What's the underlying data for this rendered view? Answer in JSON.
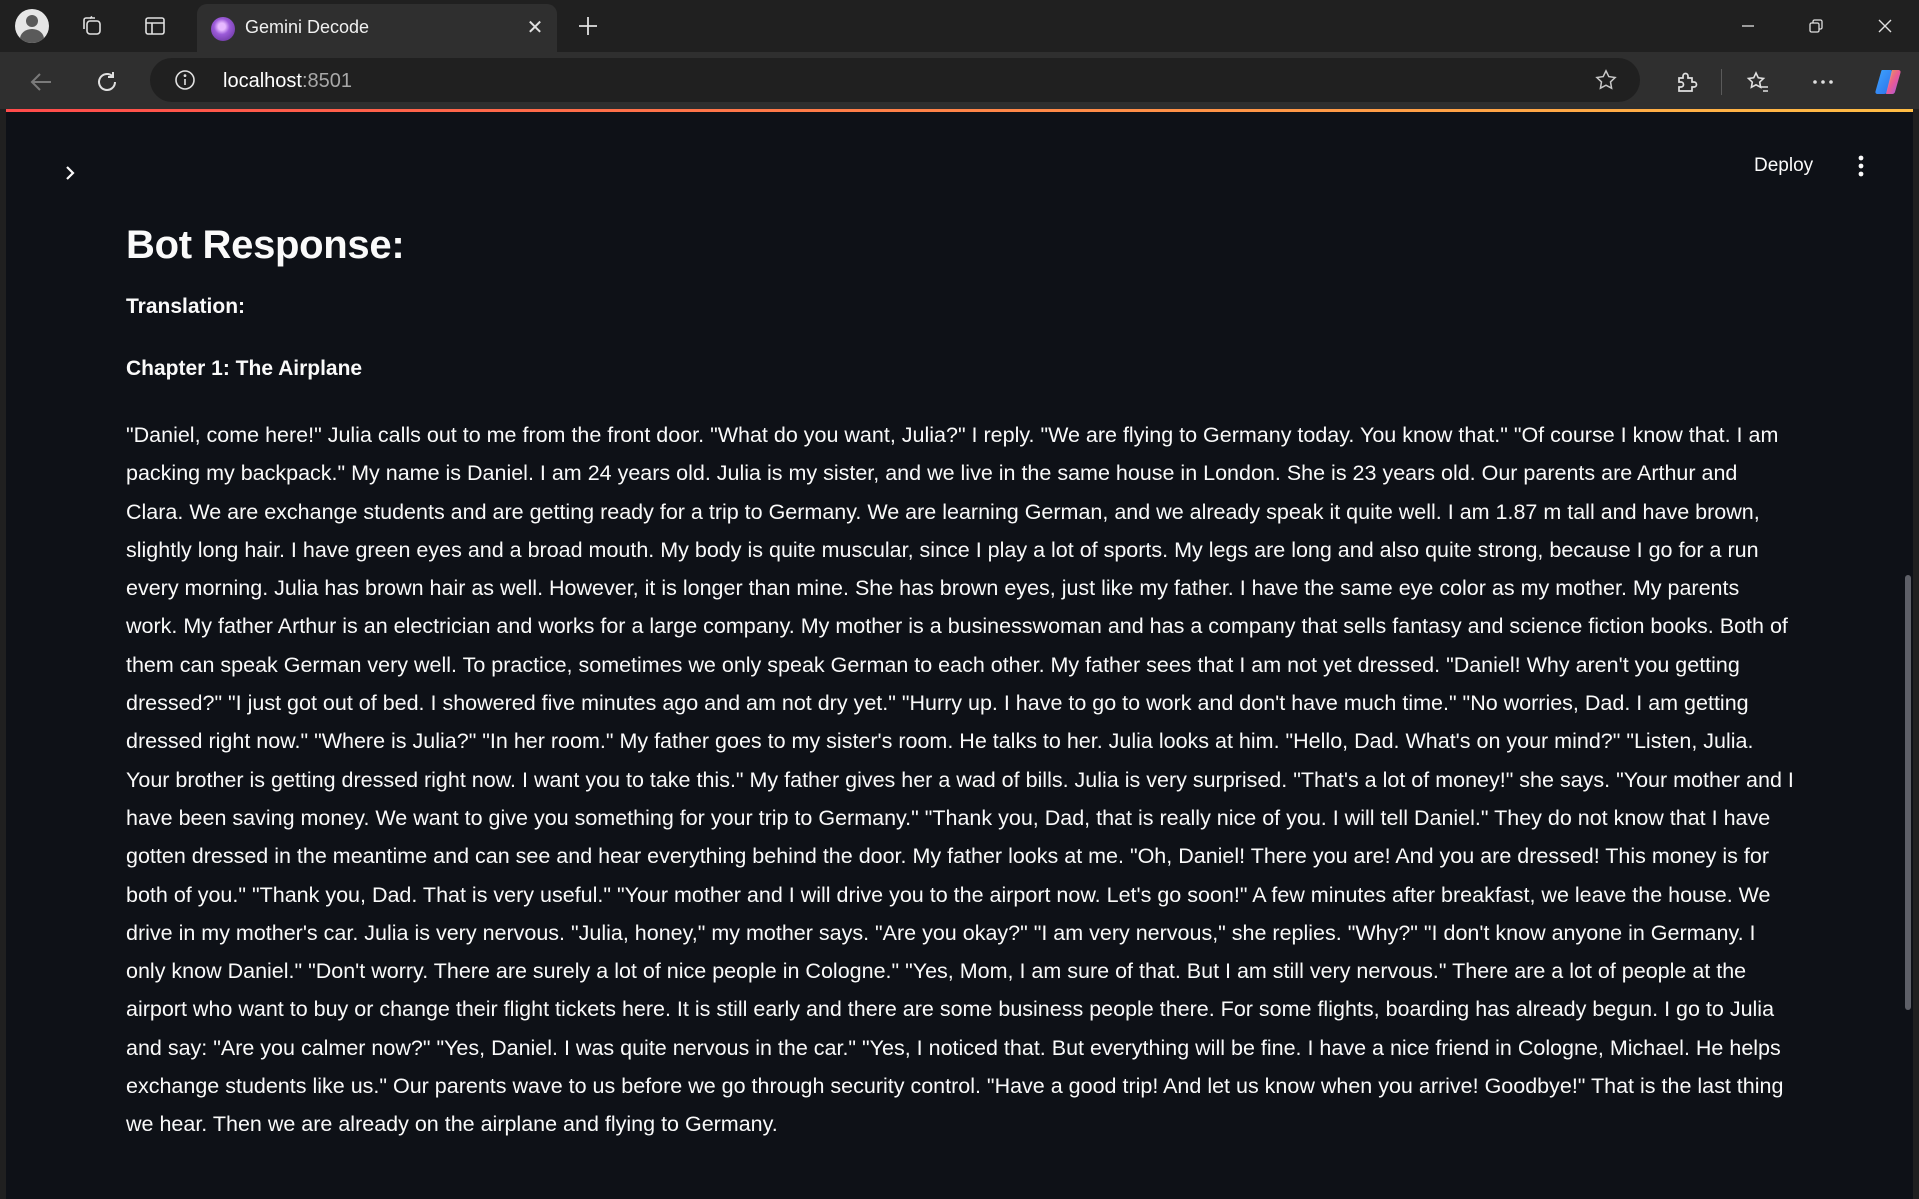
{
  "browser": {
    "tab": {
      "title": "Gemini Decode"
    },
    "url": {
      "host": "localhost",
      "port": ":8501"
    }
  },
  "icons": {
    "profile": "profile-icon",
    "workspaces": "workspaces-icon",
    "tab_actions": "tab-actions-icon",
    "new_tab": "plus-icon",
    "back": "arrow-left-icon",
    "reload": "reload-icon",
    "site_info": "info-icon",
    "favorite": "star-icon",
    "extensions": "puzzle-icon",
    "favorites": "favorites-icon",
    "more": "ellipsis-icon",
    "copilot": "copilot-icon",
    "sidebar_toggle": "chevron-right-icon",
    "app_menu": "vertical-ellipsis-icon"
  },
  "colors": {
    "app_background": "#0e1117",
    "browser_chrome": "#202020",
    "toolbar": "#2f2f2f",
    "text": "#fafafa",
    "accent_gradient_start": "#ff4b4b",
    "accent_gradient_end": "#ffbd45"
  },
  "app": {
    "header": {
      "deploy_label": "Deploy"
    },
    "main": {
      "title": "Bot Response:",
      "translation_label": "Translation:",
      "chapter_title": "Chapter 1: The Airplane",
      "story": "\"Daniel, come here!\" Julia calls out to me from the front door. \"What do you want, Julia?\" I reply. \"We are flying to Germany today. You know that.\" \"Of course I know that. I am packing my backpack.\" My name is Daniel. I am 24 years old. Julia is my sister, and we live in the same house in London. She is 23 years old. Our parents are Arthur and Clara. We are exchange students and are getting ready for a trip to Germany. We are learning German, and we already speak it quite well. I am 1.87 m tall and have brown, slightly long hair. I have green eyes and a broad mouth. My body is quite muscular, since I play a lot of sports. My legs are long and also quite strong, because I go for a run every morning. Julia has brown hair as well. However, it is longer than mine. She has brown eyes, just like my father. I have the same eye color as my mother. My parents work. My father Arthur is an electrician and works for a large company. My mother is a businesswoman and has a company that sells fantasy and science fiction books. Both of them can speak German very well. To practice, sometimes we only speak German to each other. My father sees that I am not yet dressed. \"Daniel! Why aren't you getting dressed?\" \"I just got out of bed. I showered five minutes ago and am not dry yet.\" \"Hurry up. I have to go to work and don't have much time.\" \"No worries, Dad. I am getting dressed right now.\" \"Where is Julia?\" \"In her room.\" My father goes to my sister's room. He talks to her. Julia looks at him. \"Hello, Dad. What's on your mind?\" \"Listen, Julia. Your brother is getting dressed right now. I want you to take this.\" My father gives her a wad of bills. Julia is very surprised. \"That's a lot of money!\" she says. \"Your mother and I have been saving money. We want to give you something for your trip to Germany.\" \"Thank you, Dad, that is really nice of you. I will tell Daniel.\" They do not know that I have gotten dressed in the meantime and can see and hear everything behind the door. My father looks at me. \"Oh, Daniel! There you are! And you are dressed! This money is for both of you.\" \"Thank you, Dad. That is very useful.\" \"Your mother and I will drive you to the airport now. Let's go soon!\" A few minutes after breakfast, we leave the house. We drive in my mother's car. Julia is very nervous. \"Julia, honey,\" my mother says. \"Are you okay?\" \"I am very nervous,\" she replies. \"Why?\" \"I don't know anyone in Germany. I only know Daniel.\" \"Don't worry. There are surely a lot of nice people in Cologne.\" \"Yes, Mom, I am sure of that. But I am still very nervous.\" There are a lot of people at the airport who want to buy or change their flight tickets here. It is still early and there are some business people there. For some flights, boarding has already begun. I go to Julia and say: \"Are you calmer now?\" \"Yes, Daniel. I was quite nervous in the car.\" \"Yes, I noticed that. But everything will be fine. I have a nice friend in Cologne, Michael. He helps exchange students like us.\" Our parents wave to us before we go through security control. \"Have a good trip! And let us know when you arrive! Goodbye!\" That is the last thing we hear. Then we are already on the airplane and flying to Germany."
    }
  }
}
